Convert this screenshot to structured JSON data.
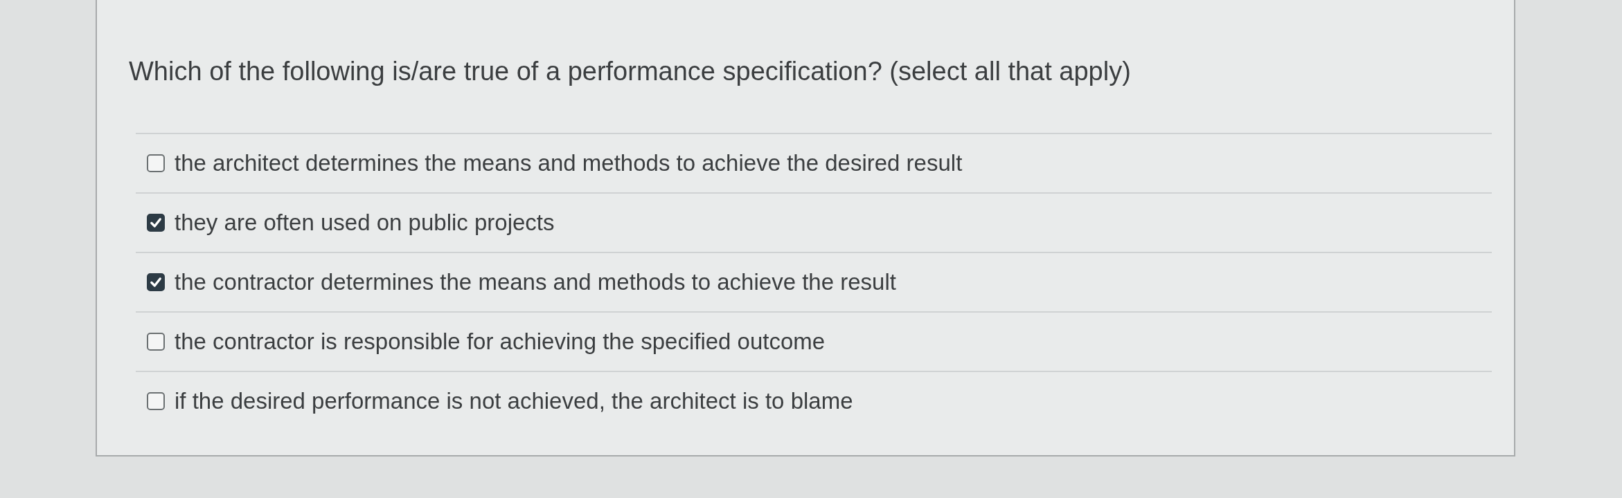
{
  "question": {
    "text": "Which of the following is/are true of a performance specification? (select all that apply)"
  },
  "options": [
    {
      "label": "the architect determines the means and methods to achieve the desired result",
      "checked": false
    },
    {
      "label": "they are often used on public projects",
      "checked": true
    },
    {
      "label": "the contractor determines the means and methods to achieve the result",
      "checked": true
    },
    {
      "label": "the contractor is responsible for achieving the specified outcome",
      "checked": false
    },
    {
      "label": "if the desired performance is not achieved, the architect is to blame",
      "checked": false
    }
  ]
}
